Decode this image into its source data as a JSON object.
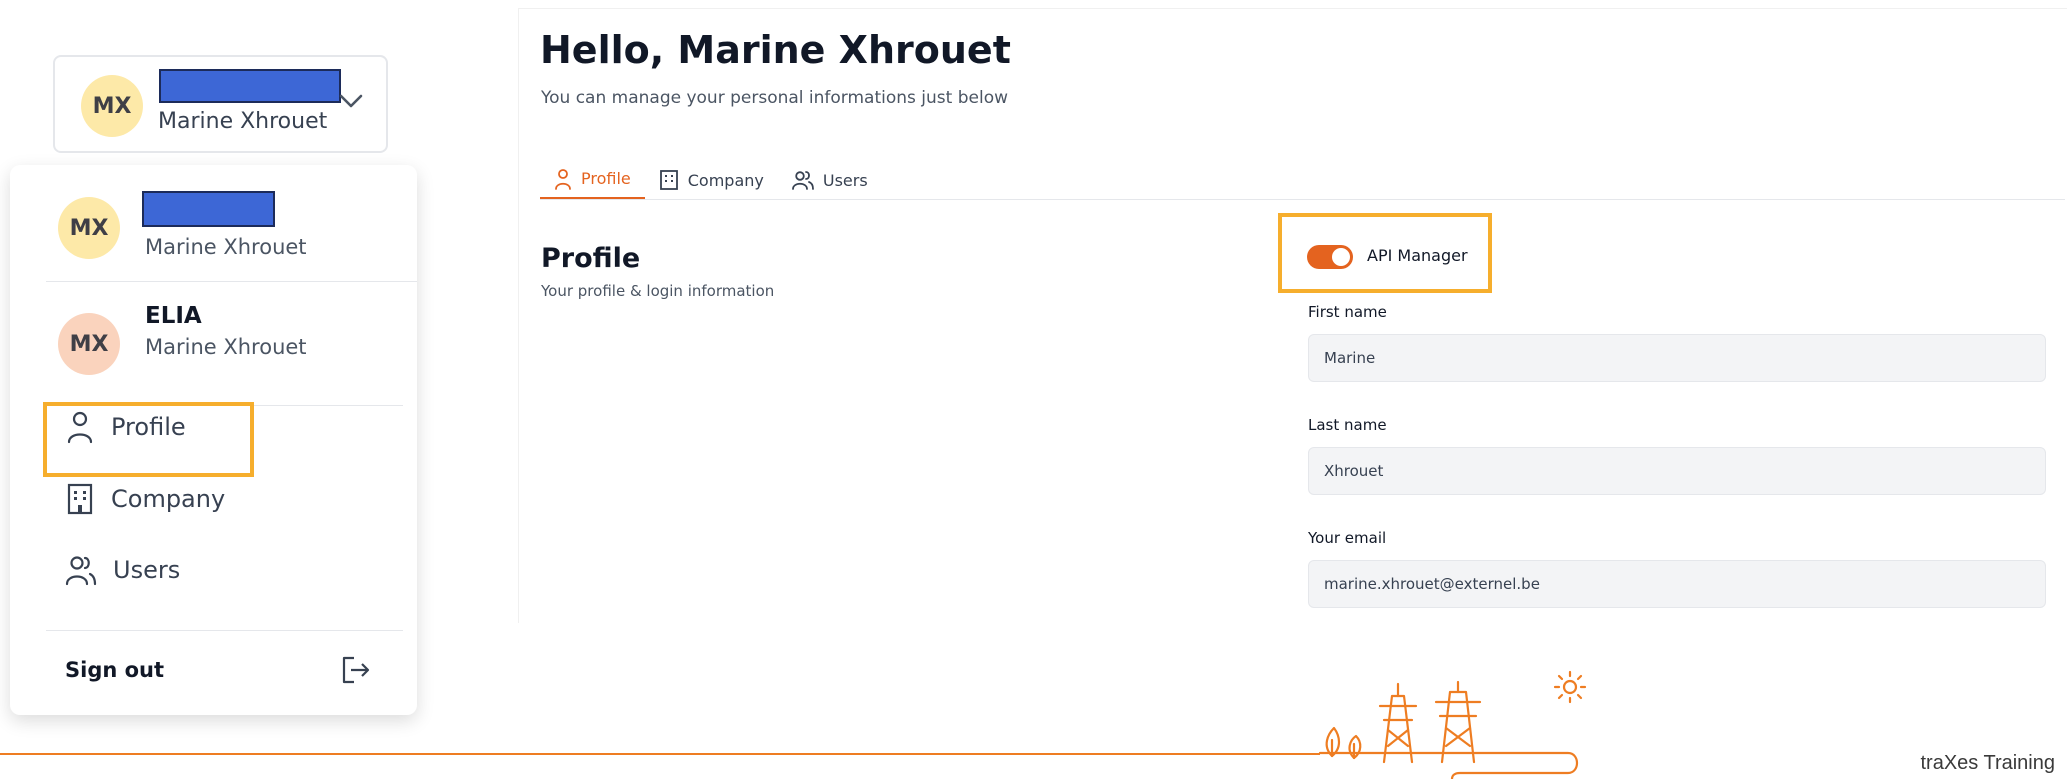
{
  "account_switcher": {
    "initials": "MX",
    "name": "Marine Xhrouet"
  },
  "menu": {
    "accounts": [
      {
        "initials": "MX",
        "org": "",
        "name": "Marine Xhrouet"
      },
      {
        "initials": "MX",
        "org": "ELIA",
        "name": "Marine Xhrouet"
      }
    ],
    "items": [
      {
        "label": "Profile",
        "icon": "user-icon"
      },
      {
        "label": "Company",
        "icon": "building-icon"
      },
      {
        "label": "Users",
        "icon": "users-icon"
      }
    ],
    "sign_out": "Sign out"
  },
  "main": {
    "greeting": "Hello, Marine Xhrouet",
    "subtitle": "You can manage your personal informations just below",
    "tabs": [
      {
        "label": "Profile",
        "icon": "user-icon",
        "active": true
      },
      {
        "label": "Company",
        "icon": "building-icon",
        "active": false
      },
      {
        "label": "Users",
        "icon": "users-icon",
        "active": false
      }
    ],
    "section_title": "Profile",
    "section_subtitle": "Your profile & login information",
    "api_manager": {
      "label": "API Manager",
      "enabled": true
    },
    "fields": {
      "first_name": {
        "label": "First name",
        "value": "Marine"
      },
      "last_name": {
        "label": "Last name",
        "value": "Xhrouet"
      },
      "email": {
        "label": "Your email",
        "value": "marine.xhrouet@externel.be"
      }
    }
  },
  "footer": {
    "brand": "traXes Training"
  },
  "colors": {
    "accent": "#e4631f",
    "highlight": "#f6ae2d",
    "redaction": "#3d67d6",
    "footer_line": "#ee7d22"
  }
}
